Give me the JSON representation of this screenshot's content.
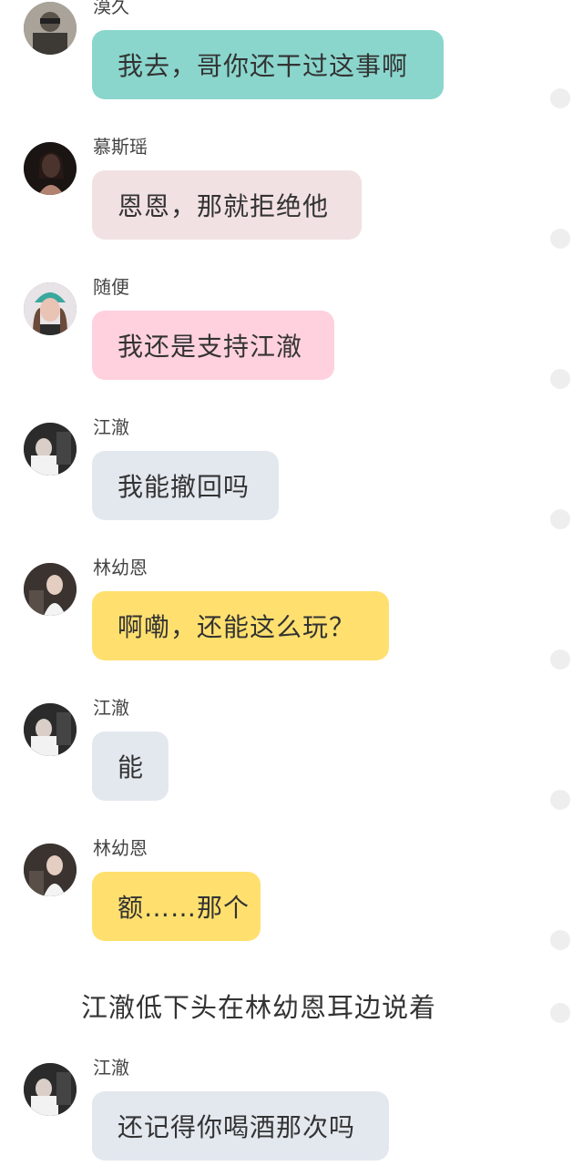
{
  "messages": [
    {
      "name": "漠久",
      "text": "我去，哥你还干过这事啊",
      "bubble_color": "#8ad6cd",
      "avatar": "avatar-mojiu"
    },
    {
      "name": "慕斯瑶",
      "text": "恩恩，那就拒绝他",
      "bubble_color": "#f2e1e3",
      "avatar": "avatar-musiyao"
    },
    {
      "name": "随便",
      "text": "我还是支持江澈",
      "bubble_color": "#ffd1de",
      "avatar": "avatar-suibian"
    },
    {
      "name": "江澈",
      "text": "我能撤回吗",
      "bubble_color": "#e3e8ef",
      "avatar": "avatar-jiangche"
    },
    {
      "name": "林幼恩",
      "text": "啊嘞，还能这么玩？",
      "bubble_color": "#ffe06f",
      "avatar": "avatar-linyouen"
    },
    {
      "name": "江澈",
      "text": "能",
      "bubble_color": "#e3e8ef",
      "avatar": "avatar-jiangche"
    },
    {
      "name": "林幼恩",
      "text": "额……那个",
      "bubble_color": "#ffe06f",
      "avatar": "avatar-linyouen"
    },
    {
      "name": "江澈",
      "text": "还记得你喝酒那次吗",
      "bubble_color": "#e3e8ef",
      "avatar": "avatar-jiangche"
    }
  ],
  "narration": "江澈低下头在林幼恩耳边说着"
}
